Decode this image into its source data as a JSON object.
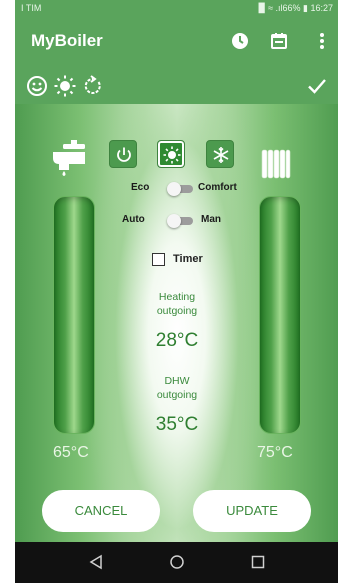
{
  "status_bar": {
    "carrier": "I TIM",
    "right_text": "▉ ≈ .ıl66% ▮ 16:27"
  },
  "app_bar": {
    "title": "MyBoiler",
    "icons": [
      "clock-icon",
      "calendar-icon",
      "more-vert-icon"
    ]
  },
  "mode_row": {
    "icons": [
      "smile-icon",
      "sun-icon",
      "refresh-icon",
      "check-icon"
    ]
  },
  "controls": {
    "mode_buttons": [
      "power-icon",
      "sun-icon",
      "snowflake-icon"
    ],
    "selected_mode": "sun-icon",
    "eco_label": "Eco",
    "comfort_label": "Comfort",
    "auto_label": "Auto",
    "man_label": "Man",
    "timer_label": "Timer"
  },
  "readings": {
    "heating_label": "Heating\noutgoing",
    "heating_value": "28°C",
    "dhw_label": "DHW\noutgoing",
    "dhw_value": "35°C"
  },
  "gauges": {
    "left_value": "65°C",
    "right_value": "75°C"
  },
  "actions": {
    "cancel_label": "CANCEL",
    "update_label": "UPDATE"
  },
  "nav_bar": {
    "icons": [
      "back-icon",
      "home-icon",
      "recents-icon"
    ]
  },
  "colors": {
    "primary_green": "#5aa45c",
    "gauge_green": "#4fa049",
    "text_green": "#3a8a3c"
  }
}
